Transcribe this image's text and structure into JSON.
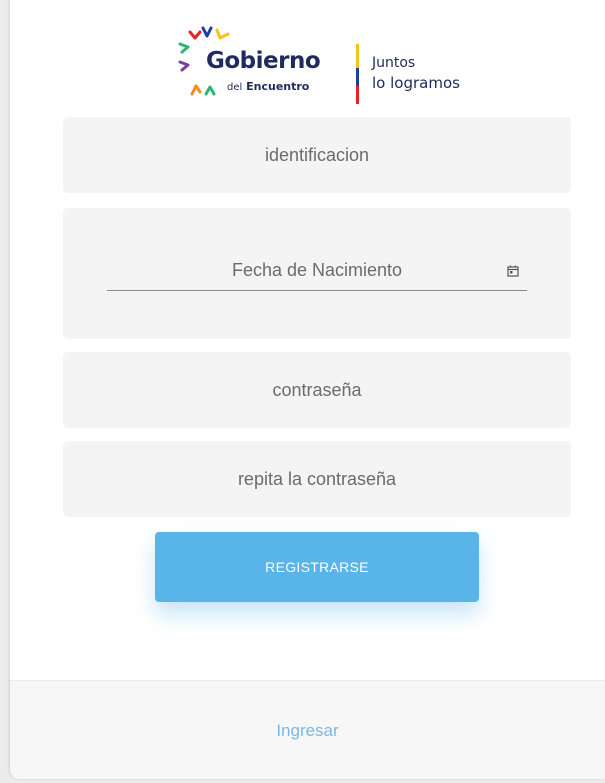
{
  "logo": {
    "name_main": "Gobierno",
    "name_sub_prefix": "del",
    "name_sub": "Encuentro",
    "tagline_line1": "Juntos",
    "tagline_line2": "lo logramos"
  },
  "form": {
    "identification_placeholder": "identificacion",
    "birthdate_placeholder": "Fecha de Nacimiento",
    "password_placeholder": "contraseña",
    "repeat_password_placeholder": "repita la contraseña",
    "register_label": "REGISTRARSE"
  },
  "footer": {
    "login_link": "Ingresar"
  },
  "colors": {
    "button": "#58b4e9",
    "field_bg": "#f4f4f4",
    "link": "#7fb6e6",
    "logo_text": "#1f2a5e"
  },
  "icons": {
    "calendar": "calendar-icon"
  }
}
